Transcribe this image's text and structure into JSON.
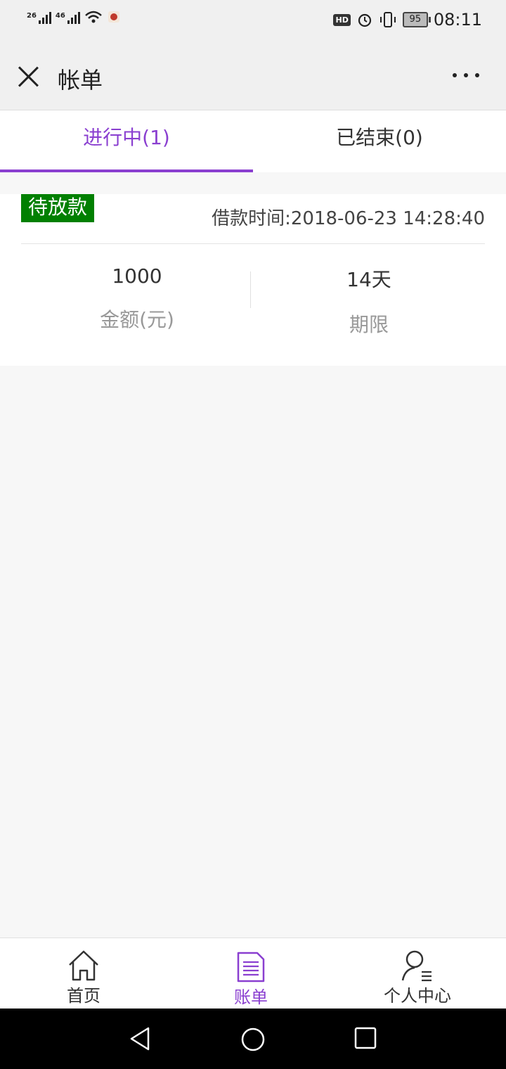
{
  "status": {
    "sig1": "26",
    "sig2": "46",
    "hd": "HD",
    "battery": "95",
    "time": "08:11"
  },
  "header": {
    "title": "帐单"
  },
  "tabs": [
    {
      "label": "进行中(1)"
    },
    {
      "label": "已结束(0)"
    }
  ],
  "loan": {
    "status": "待放款",
    "time": "借款时间:2018-06-23 14:28:40",
    "amount": "1000",
    "amount_label": "金额(元)",
    "term": "14天",
    "term_label": "期限"
  },
  "bottom_nav": [
    {
      "label": "首页"
    },
    {
      "label": "账单"
    },
    {
      "label": "个人中心"
    }
  ],
  "colors": {
    "accent": "#8a3fd0",
    "badge": "#018001"
  }
}
